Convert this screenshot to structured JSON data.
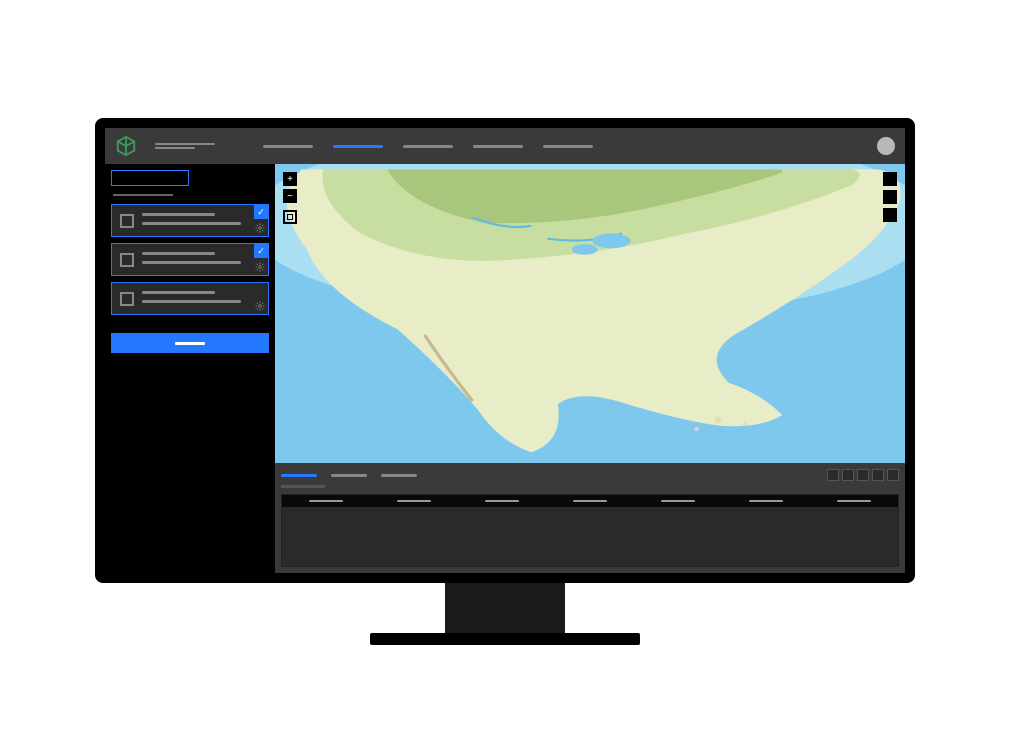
{
  "header": {
    "app_name_icon": "cube-logo",
    "title_line1": "",
    "title_line2": "",
    "nav": [
      "",
      "",
      "",
      "",
      ""
    ],
    "active_nav_index": 1,
    "avatar": "user-avatar"
  },
  "sidebar": {
    "tabs": [
      "",
      ""
    ],
    "active_tab_index": 0,
    "subtitle": "",
    "cards": [
      {
        "checked": true,
        "line1": "",
        "line2": "",
        "settings_icon": "gear-icon"
      },
      {
        "checked": true,
        "line1": "",
        "line2": "",
        "settings_icon": "gear-icon"
      },
      {
        "checked": false,
        "line1": "",
        "line2": "",
        "settings_icon": "gear-icon"
      }
    ],
    "primary_button_label": ""
  },
  "map": {
    "controls": {
      "zoom_in": "+",
      "zoom_out": "−",
      "home": "□"
    },
    "right_buttons": [
      "",
      "",
      ""
    ],
    "region": "North America"
  },
  "bottom_panel": {
    "tabs": [
      "",
      "",
      ""
    ],
    "active_tab_index": 0,
    "subtitle": "",
    "icons": [
      "",
      "",
      "",
      "",
      ""
    ],
    "table": {
      "columns": [
        "",
        "",
        "",
        "",
        "",
        "",
        ""
      ],
      "rows": []
    }
  },
  "colors": {
    "accent": "#2478ff",
    "panel": "#3a3a3a",
    "card": "#2a2a2a"
  }
}
